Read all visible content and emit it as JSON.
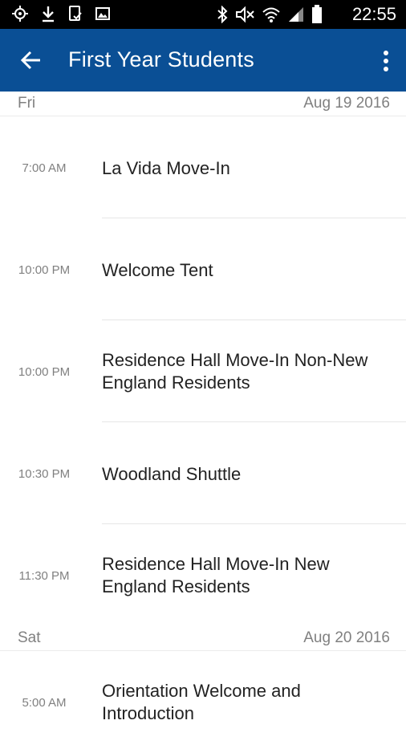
{
  "status_bar": {
    "time": "22:55",
    "left_icons": [
      "gps-icon",
      "download-icon",
      "file-icon",
      "image-icon"
    ],
    "right_icons": [
      "bluetooth-icon",
      "mute-icon",
      "wifi-icon",
      "signal-icon",
      "battery-icon"
    ]
  },
  "app_bar": {
    "title": "First Year Students",
    "back_icon": "arrow-back-icon",
    "menu_icon": "more-vert-icon",
    "color": "#0a4f95"
  },
  "days": [
    {
      "day": "Fri",
      "date": "Aug 19 2016",
      "events": [
        {
          "time": "7:00 AM",
          "title": "La Vida Move-In"
        },
        {
          "time": "10:00 PM",
          "title": "Welcome Tent"
        },
        {
          "time": "10:00 PM",
          "title": "Residence Hall Move-In Non-New England Residents"
        },
        {
          "time": "10:30 PM",
          "title": "Woodland Shuttle"
        },
        {
          "time": "11:30 PM",
          "title": "Residence Hall Move-In New England Residents"
        }
      ]
    },
    {
      "day": "Sat",
      "date": "Aug 20 2016",
      "events": [
        {
          "time": "5:00 AM",
          "title": "Orientation Welcome and Introduction"
        }
      ]
    }
  ]
}
